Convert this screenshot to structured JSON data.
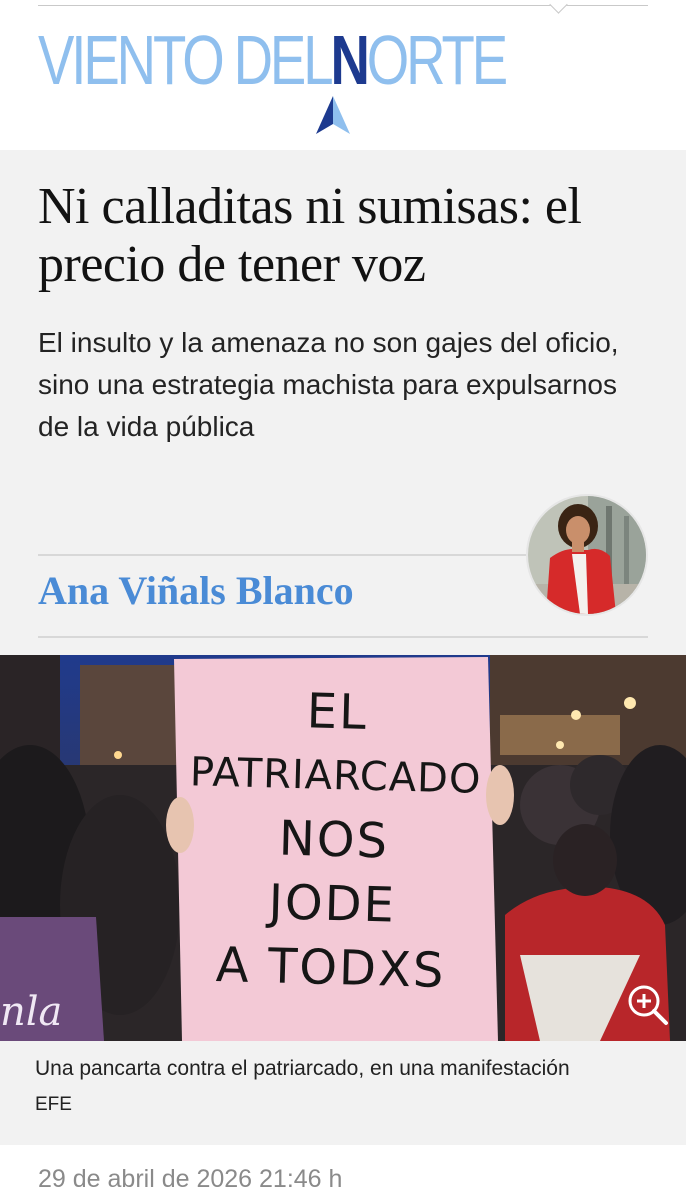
{
  "header": {
    "logo_part1": "VIENTO DEL ",
    "logo_n": "N",
    "logo_part2": "ORTE",
    "logo_color": "#8fbfee",
    "logo_n_color": "#1d3a8f"
  },
  "article": {
    "headline": "Ni calladitas ni sumisas: el precio de tener voz",
    "subtitle": "El insulto y la amenaza no son gajes del oficio, sino una estrategia machista para expulsarnos de la vida pública",
    "author": "Ana Viñals Blanco",
    "author_color": "#4a8bd6",
    "image": {
      "sign_lines": [
        "EL",
        "PATRIARCADO",
        "NOS",
        "JODE",
        "A TODXS"
      ],
      "partial_sign_text": "nla",
      "caption": "Una pancarta contra el patriarcado, en una manifestación",
      "credit": "EFE",
      "zoom_icon": "zoom-in-icon"
    },
    "date": "29 de abril de 2026 21:46 h"
  }
}
